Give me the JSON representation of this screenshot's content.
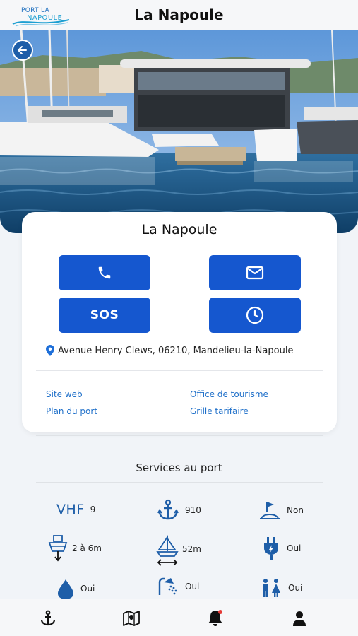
{
  "header": {
    "logo_line1": "PORT LA",
    "logo_line2": "NAPOULE",
    "title": "La Napoule"
  },
  "card": {
    "name": "La Napoule",
    "buttons": {
      "phone_icon": "phone-icon",
      "mail_icon": "mail-icon",
      "sos_label": "SOS",
      "clock_icon": "clock-icon"
    },
    "address": "Avenue Henry Clews, 06210, Mandelieu-la-Napoule",
    "links": {
      "website": "Site web",
      "tourism_office": "Office de tourisme",
      "port_plan": "Plan du port",
      "rates": "Grille tarifaire"
    }
  },
  "services": {
    "title": "Services au port",
    "vhf_label": "VHF",
    "vhf_value": "9",
    "berths_value": "910",
    "fuel_value": "Non",
    "draft_value": "2 à 6m",
    "length_value": "52m",
    "electricity_value": "Oui",
    "water_value": "Oui",
    "shower_value": "Oui",
    "toilets_value": "Oui"
  },
  "tabbar": {
    "items": [
      "anchor-icon",
      "map-icon",
      "bell-icon",
      "user-icon"
    ]
  },
  "colors": {
    "primary": "#1557cf",
    "accent": "#1e5ea8",
    "link": "#1e6fc9"
  }
}
